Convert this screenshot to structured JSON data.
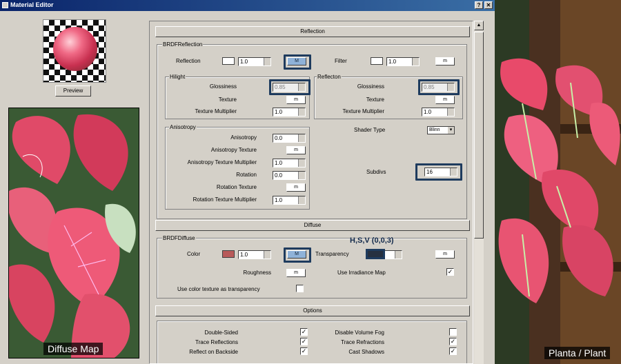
{
  "window": {
    "title": "Material Editor",
    "help_label": "?",
    "close_label": "✕"
  },
  "left": {
    "preview_button": "Preview",
    "diffuse_map_label": "Diffuse Map"
  },
  "right": {
    "plant_label": "Planta / Plant"
  },
  "reflection": {
    "header": "Reflection",
    "group": "BRDFReflection",
    "reflection_label": "Reflection",
    "reflection_value": "1.0",
    "reflection_map": "M",
    "filter_label": "Filter",
    "filter_value": "1.0",
    "filter_map": "m",
    "hilight": {
      "title": "Hilight",
      "glossiness_label": "Glossiness",
      "glossiness_value": "0.85",
      "texture_label": "Texture",
      "texture_map": "m",
      "multiplier_label": "Texture Multiplier",
      "multiplier_value": "1.0"
    },
    "reflect": {
      "title": "Reflecton",
      "glossiness_label": "Glossiness",
      "glossiness_value": "0.85",
      "texture_label": "Texture",
      "texture_map": "m",
      "multiplier_label": "Texture Multiplier",
      "multiplier_value": "1.0"
    },
    "anisotropy": {
      "title": "Anisotropy",
      "anisotropy_label": "Anisotropy",
      "anisotropy_value": "0.0",
      "aniso_texture_label": "Anisotropy Texture",
      "aniso_texture_map": "m",
      "aniso_mult_label": "Anisotropy Texture Multiplier",
      "aniso_mult_value": "1.0",
      "rotation_label": "Rotation",
      "rotation_value": "0.0",
      "rotation_texture_label": "Rotation Texture",
      "rotation_texture_map": "m",
      "rotation_mult_label": "Rotation Texture Multiplier",
      "rotation_mult_value": "1.0"
    },
    "shader_type_label": "Shader Type",
    "shader_type_value": "Blinn",
    "subdivs_label": "Subdivs",
    "subdivs_value": "16"
  },
  "diffuse": {
    "header": "Diffuse",
    "group": "BRDFDiffuse",
    "color_label": "Color",
    "color_value": "1.0",
    "color_map": "M",
    "color_swatch": "#b85a5a",
    "hsv_annotation": "H,S,V (0,0,3)",
    "transparency_label": "Transparency",
    "transparency_value": "1.0",
    "transparency_map": "m",
    "roughness_label": "Roughness",
    "roughness_map": "m",
    "irradiance_label": "Use Irradiance Map",
    "irradiance_checked": "✓",
    "color_as_transparency_label": "Use color texture as transparency",
    "color_as_transparency_checked": ""
  },
  "options": {
    "header": "Options",
    "double_sided_label": "Double-Sided",
    "double_sided_checked": "✓",
    "trace_reflections_label": "Trace Reflections",
    "trace_reflections_checked": "✓",
    "reflect_backside_label": "Reflect on Backside",
    "reflect_backside_checked": "✓",
    "disable_fog_label": "Disable Volume Fog",
    "disable_fog_checked": "",
    "trace_refractions_label": "Trace Refractions",
    "trace_refractions_checked": "✓",
    "cast_shadows_label": "Cast Shadows",
    "cast_shadows_checked": "✓"
  }
}
